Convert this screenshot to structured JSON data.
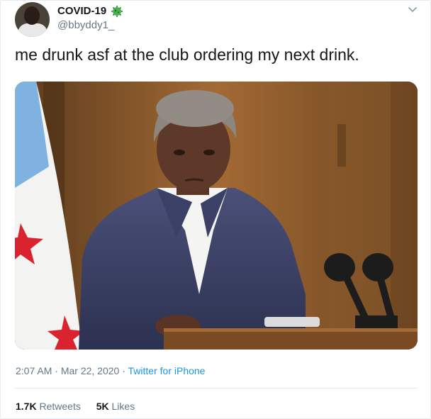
{
  "header": {
    "display_name": "COVID-19",
    "handle": "@bbyddy1_",
    "badge_icon": "virus-emoji-icon",
    "menu_icon": "chevron-down-icon"
  },
  "tweet": {
    "text": "me drunk asf at the club ordering my next drink."
  },
  "footer": {
    "time": "2:07 AM",
    "separator1": "·",
    "date": "Mar 22, 2020",
    "separator2": "·",
    "source": "Twitter for iPhone"
  },
  "stats": {
    "retweets_count": "1.7K",
    "retweets_label": "Retweets",
    "likes_count": "5K",
    "likes_label": "Likes"
  },
  "colors": {
    "text": "#14171a",
    "secondary": "#657786",
    "link": "#1b95e0",
    "divider": "#e6ecf0"
  }
}
